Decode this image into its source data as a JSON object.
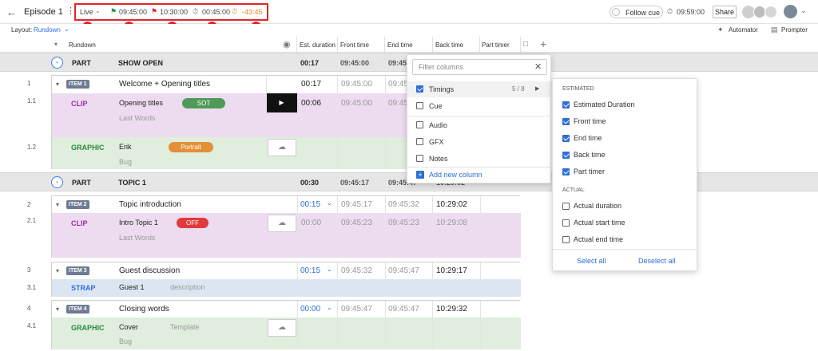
{
  "topbar": {
    "back_icon": "arrow-left-icon",
    "episode": "Episode 1",
    "live": "Live",
    "t1": "09:45:00",
    "t2": "10:30:00",
    "t3": "00:45:00",
    "t4": "-43:45",
    "follow_cue": "Follow cue",
    "clock": "09:59:00",
    "share": "Share",
    "markers": [
      "1",
      "2",
      "3",
      "4",
      "5"
    ]
  },
  "subbar": {
    "layout_label": "Layout:",
    "layout_value": "Rundown",
    "automator": "Automator",
    "prompter": "Prompter"
  },
  "columns": {
    "rundown": "Rundown",
    "est": "Est. duration",
    "front": "Front time",
    "end": "End time",
    "back": "Back time",
    "part_timer": "Part timer"
  },
  "part1": {
    "label": "PART",
    "title": "SHOW OPEN",
    "est": "00:17",
    "front": "09:45:00",
    "end": "09:45:17"
  },
  "item1": {
    "num": "1",
    "badge": "ITEM 1",
    "title": "Welcome + Opening titles",
    "est": "00:17",
    "front": "09:45:00",
    "end": "09:45:17",
    "clip": {
      "num": "1.1",
      "type": "CLIP",
      "title": "Opening titles",
      "pill": "SOT",
      "sub": "Last Words",
      "est": "00:06",
      "front": "09:45:00",
      "end": "09:45:06"
    },
    "graphic": {
      "num": "1.2",
      "type": "GRAPHIC",
      "title": "Erik",
      "pill": "Portrait",
      "sub": "Bug"
    }
  },
  "part2": {
    "label": "PART",
    "title": "TOPIC 1",
    "est": "00:30",
    "front": "09:45:17",
    "end": "09:45:47",
    "back": "10:29:02"
  },
  "item2": {
    "num": "2",
    "badge": "ITEM 2",
    "title": "Topic introduction",
    "est": "00:15",
    "front": "09:45:17",
    "end": "09:45:32",
    "back": "10:29:02",
    "clip": {
      "num": "2.1",
      "type": "CLIP",
      "title": "Intro Topic 1",
      "pill": "OFF",
      "sub": "Last Words",
      "est": "00:00",
      "front": "09:45:23",
      "end": "09:45:23",
      "back": "10:29:08"
    }
  },
  "item3": {
    "num": "3",
    "badge": "ITEM 3",
    "title": "Guest discussion",
    "est": "00:15",
    "front": "09:45:32",
    "end": "09:45:47",
    "back": "10:29:17",
    "strap": {
      "num": "3.1",
      "type": "STRAP",
      "title": "Guest 1",
      "desc": "description"
    }
  },
  "item4": {
    "num": "4",
    "badge": "ITEM 4",
    "title": "Closing words",
    "est": "00:00",
    "front": "09:45:47",
    "end": "09:45:47",
    "back": "10:29:32",
    "graphic": {
      "num": "4.1",
      "type": "GRAPHIC",
      "title": "Cover",
      "template": "Template",
      "sub": "Bug"
    }
  },
  "filter": {
    "placeholder": "Filter columns",
    "timings": "Timings",
    "timings_count": "5 / 8",
    "cue": "Cue",
    "audio": "Audio",
    "gfx": "GFX",
    "notes": "Notes",
    "add": "Add new column"
  },
  "timings_panel": {
    "estimated": "ESTIMATED",
    "est_duration": "Estimated Duration",
    "front": "Front time",
    "end": "End time",
    "back": "Back time",
    "part_timer": "Part timer",
    "actual": "ACTUAL",
    "act_duration": "Actual duration",
    "act_start": "Actual start time",
    "act_end": "Actual end time",
    "select_all": "Select all",
    "deselect_all": "Deselect all"
  },
  "colors": {
    "accent": "#2f6fd6",
    "clip_bg": "#eddcef",
    "graphic_bg": "#dfeedd",
    "strap_bg": "#dce6f3",
    "marker": "#e0262b"
  }
}
